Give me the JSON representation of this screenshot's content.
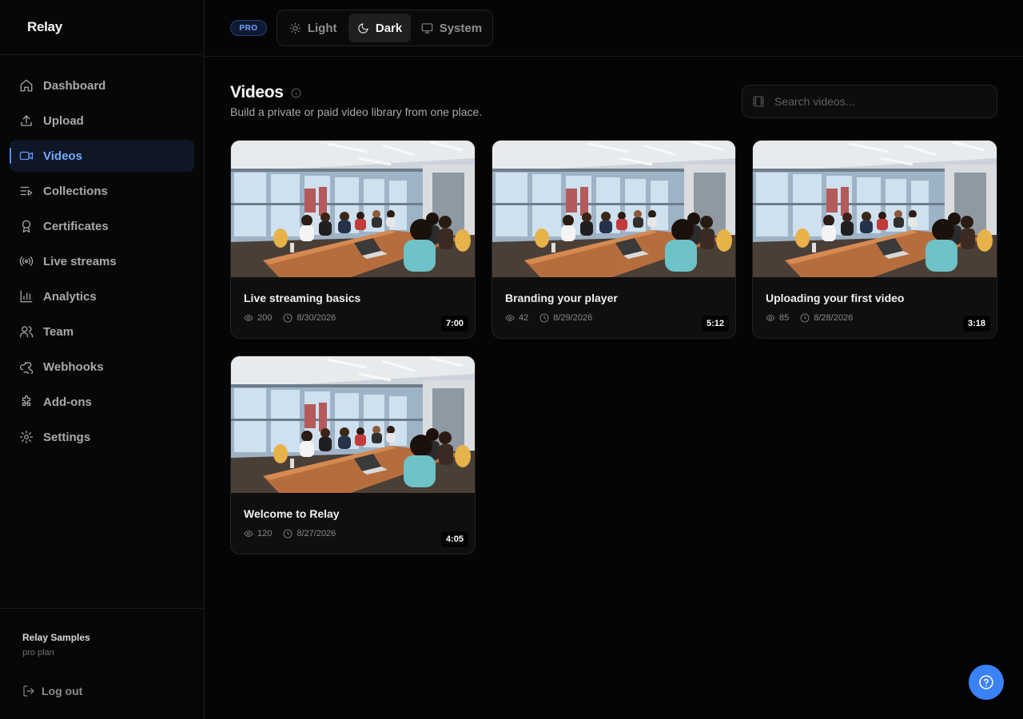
{
  "app": {
    "logo": "Relay",
    "logo_sub": ""
  },
  "sidebar": {
    "items": [
      {
        "label": "Dashboard",
        "icon": "home-icon"
      },
      {
        "label": "Upload",
        "icon": "upload-icon"
      },
      {
        "label": "Videos",
        "icon": "video-icon",
        "active": true
      },
      {
        "label": "Collections",
        "icon": "list-video-icon"
      },
      {
        "label": "Certificates",
        "icon": "award-icon"
      },
      {
        "label": "Live streams",
        "icon": "radio-icon"
      },
      {
        "label": "Analytics",
        "icon": "bar-chart-icon"
      },
      {
        "label": "Team",
        "icon": "users-icon"
      },
      {
        "label": "Webhooks",
        "icon": "webhook-icon"
      },
      {
        "label": "Add-ons",
        "icon": "puzzle-icon"
      },
      {
        "label": "Settings",
        "icon": "gear-icon"
      }
    ],
    "org_name": "Relay Samples",
    "org_plan": "pro plan",
    "logout_label": "Log out"
  },
  "topbar": {
    "plan_badge": "PRO",
    "theme_options": [
      {
        "label": "Light",
        "icon": "sun-icon"
      },
      {
        "label": "Dark",
        "icon": "moon-icon",
        "active": true
      },
      {
        "label": "System",
        "icon": "monitor-icon"
      }
    ]
  },
  "main": {
    "title": "Videos",
    "subtitle": "Build a private or paid video library from one place.",
    "search_placeholder": "Search videos..."
  },
  "videos": [
    {
      "title": "Live streaming basics",
      "duration": "7:00",
      "views": "200",
      "date": "8/30/2026"
    },
    {
      "title": "Branding your player",
      "duration": "5:12",
      "views": "42",
      "date": "8/29/2026"
    },
    {
      "title": "Uploading your first video",
      "duration": "3:18",
      "views": "85",
      "date": "8/28/2026"
    },
    {
      "title": "Welcome to Relay",
      "duration": "4:05",
      "views": "120",
      "date": "8/27/2026"
    }
  ],
  "colors": {
    "accent": "#3b82f6",
    "active_nav_bg": "#0f1726",
    "active_nav_text": "#74a9ff",
    "background": "#050505"
  }
}
